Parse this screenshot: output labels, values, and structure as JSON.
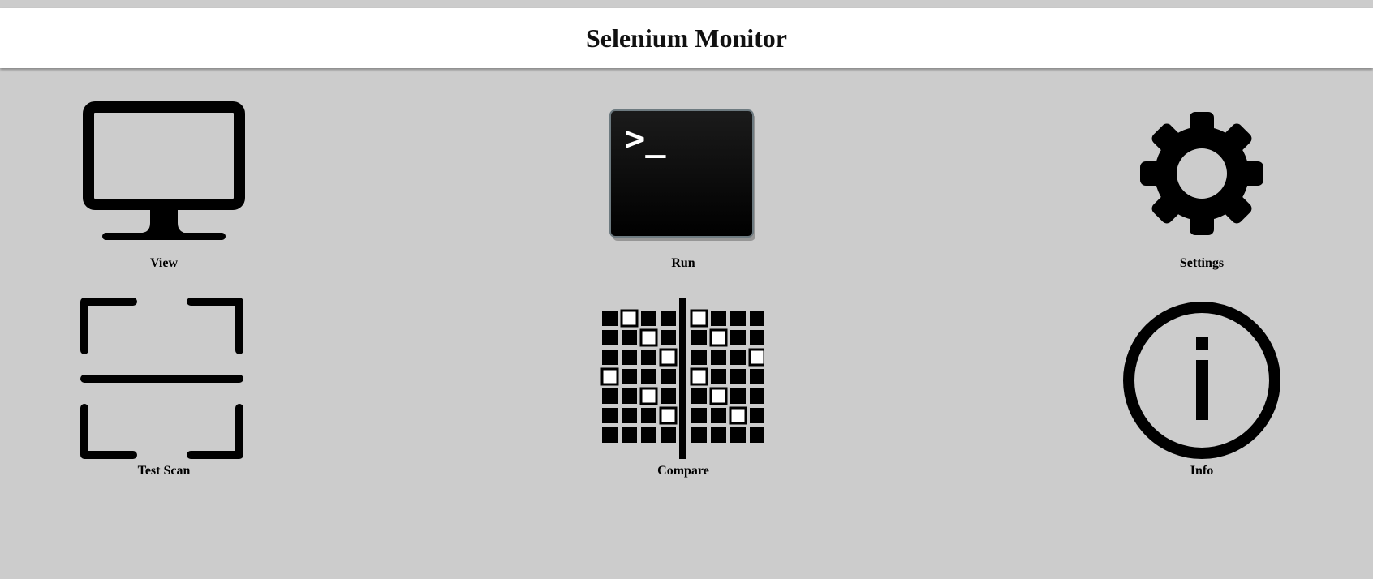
{
  "header": {
    "title": "Selenium Monitor"
  },
  "tiles": [
    {
      "label": "View",
      "icon": "monitor-icon"
    },
    {
      "label": "Run",
      "icon": "terminal-icon",
      "terminal_prompt": ">_"
    },
    {
      "label": "Settings",
      "icon": "gear-icon"
    },
    {
      "label": "Test Scan",
      "icon": "scan-icon"
    },
    {
      "label": "Compare",
      "icon": "compare-grid-icon"
    },
    {
      "label": "Info",
      "icon": "info-icon"
    }
  ],
  "colors": {
    "background": "#cccccc",
    "header_background": "#ffffff",
    "icon": "#000000"
  }
}
